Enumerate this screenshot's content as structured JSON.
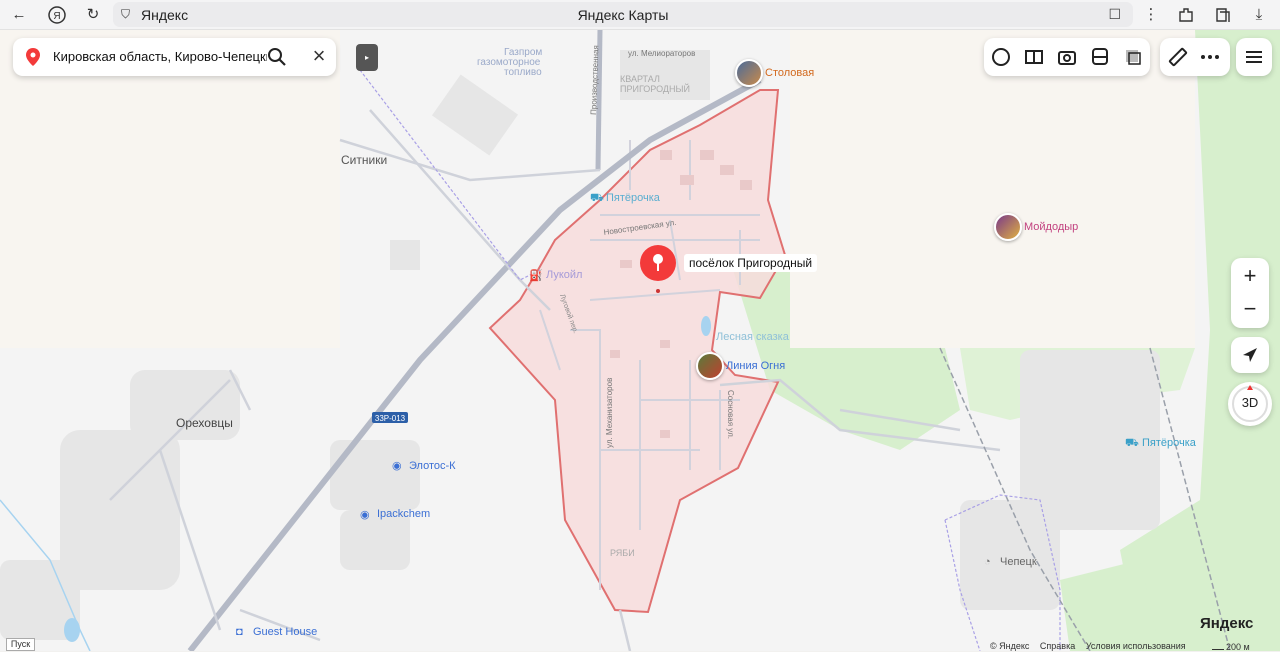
{
  "browser": {
    "site": "Яндекс",
    "title": "Яндекс Карты"
  },
  "search": {
    "value": "Кировская область, Кирово-Чепецки"
  },
  "place": {
    "name": "посёлок Пригородный"
  },
  "pois": {
    "stolovaya": "Столовая",
    "pyaterochka_north": "Пятёрочка",
    "moydodyr": "Мойдодыр",
    "lukoil": "Лукойл",
    "lesnaya_skazka": "Лесная сказка",
    "liniya_ognya": "Линия Огня",
    "pyaterochka_east": "Пятёрочка",
    "elotos": "Элотос-К",
    "ipackchem": "Ipackchem",
    "guest_house": "Guest House",
    "chepetsk_poi": "Чепецк",
    "gazprom_1": "Газпром",
    "gazprom_2": "газомоторное",
    "gazprom_3": "топливо"
  },
  "map_labels": {
    "sitniki": "Ситники",
    "orekhovtsy": "Ореховцы",
    "kvartal_1": "КВАРТАЛ",
    "kvartal_2": "ПРИГОРОДНЫЙ",
    "ryabi": "РЯБИ",
    "road_code": "33Р-013",
    "street_meliorators": "ул. Мелиораторов",
    "street_novostroevskaya": "Новостроевская ул.",
    "street_mekhanizatorov": "ул. Механизаторов",
    "street_sosnovaya": "Сосновая ул.",
    "street_proizvodstvennaya": "Производственная",
    "street_lugovoy": "Луговой пер."
  },
  "controls": {
    "zoom_in": "+",
    "zoom_out": "−",
    "compass": "3D",
    "collapse": "▸"
  },
  "footer": {
    "copyright": "© Яндекс",
    "help": "Справка",
    "terms": "Условия использования",
    "logo": "Яндекс",
    "scale": "200 м",
    "launch": "Пуск"
  },
  "colors": {
    "boundary_fill": "#f7dcdc",
    "boundary_stroke": "#e07070",
    "forest": "#d7efcd",
    "poi_orange": "#d2691e",
    "poi_pink": "#c2417f",
    "poi_blue": "#3b6fd4"
  }
}
